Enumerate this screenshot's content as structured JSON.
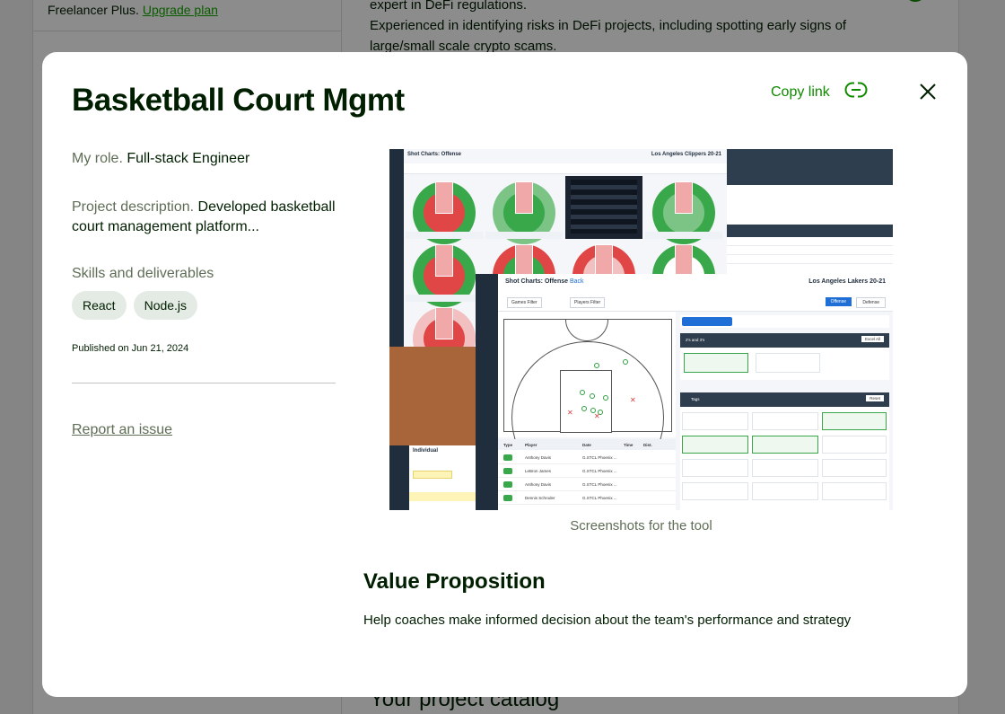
{
  "background": {
    "plan_text": "Freelancer Plus.",
    "upgrade_link": "Upgrade plan",
    "bio_line1": "expert in DeFi regulations.",
    "bio_line2": "Experienced in identifying risks in DeFi projects, including spotting early signs of",
    "bio_line3": "large/small scale crypto scams.",
    "catalog_heading": "Your project catalog"
  },
  "modal": {
    "title": "Basketball Court Mgmt",
    "copy_link": "Copy link",
    "role_label": "My role.",
    "role_value": "Full-stack Engineer",
    "desc_label": "Project description.",
    "desc_value": "Developed basketball court management platform...",
    "skills_label": "Skills and deliverables",
    "skills": [
      "React",
      "Node.js"
    ],
    "published": "Published on Jun 21, 2024",
    "report_issue": "Report an issue",
    "caption": "Screenshots for the tool",
    "value_prop_title": "Value Proposition",
    "value_prop_text": "Help coaches make informed decision about the team's performance and strategy"
  },
  "screenshot": {
    "back_title": "Shot Charts: Offense",
    "back_team": "Los Angeles Clippers 20-21",
    "front_title": "Shot Charts: Offense",
    "front_back_link": "Back",
    "front_team": "Los Angeles Lakers 20-21",
    "front_game_filter": "Games Filter",
    "front_players_filter": "Players Filter",
    "front_tab_offense": "Offense",
    "front_tab_defense": "Defense",
    "table_headers": [
      "Type",
      "Player",
      "Date",
      "Time",
      "Dist."
    ],
    "table_rows": [
      {
        "player": "Anthony Davis",
        "date": "G.STCL Phoenix ..."
      },
      {
        "player": "LeBron James",
        "date": "G.STCL Phoenix ..."
      },
      {
        "player": "Anthony Davis",
        "date": "G.STCL Phoenix ..."
      },
      {
        "player": "Dennis Schroder",
        "date": "G.STCL Phoenix ..."
      }
    ],
    "section_2s3s": "2's and 3's",
    "section_tags": "Tags",
    "btn_excel": "Excel All",
    "btn_reset": "Reset",
    "individual_title": "Individual",
    "colors": {
      "court_green": "#39a84a",
      "court_red": "#e04646",
      "sidebar": "#1f2d3d",
      "accent_blue": "#1f6fd6"
    }
  }
}
